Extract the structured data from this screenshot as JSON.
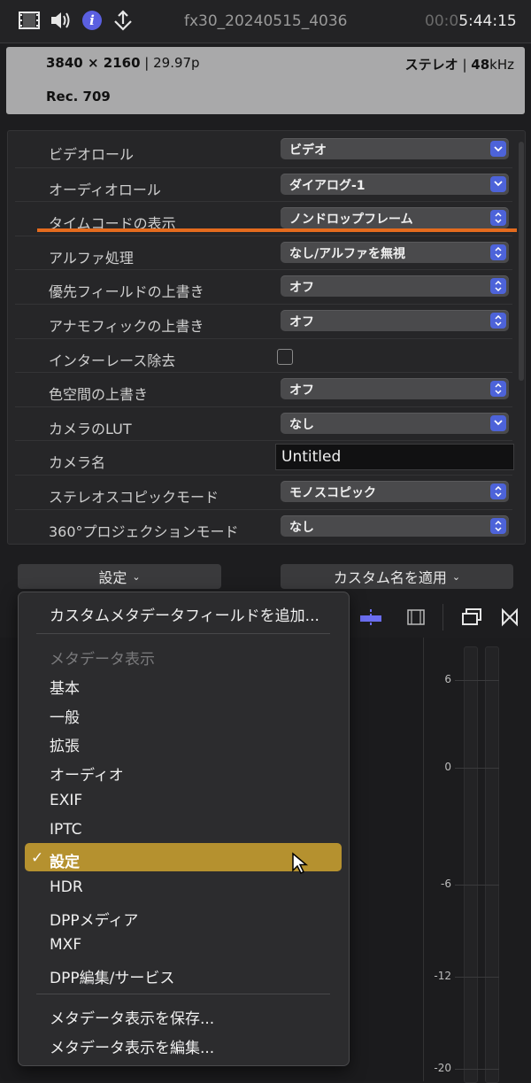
{
  "toolbar": {
    "clip_name": "fx30_20240515_4036",
    "timecode_dim": "00:0",
    "timecode": "5:44:15",
    "icons": [
      "film-icon",
      "speaker-icon",
      "info-icon",
      "share-icon"
    ]
  },
  "info": {
    "resolution": "3840 × 2160",
    "framerate": "29.97p",
    "audio_channels": "ステレオ",
    "sample_rate": "48",
    "sample_unit": "kHz",
    "color_space": "Rec. 709"
  },
  "settings": [
    {
      "label": "ビデオロール",
      "value": "ビデオ",
      "type": "select-down"
    },
    {
      "label": "オーディオロール",
      "value": "ダイアログ-1",
      "type": "select-down"
    },
    {
      "label": "タイムコードの表示",
      "value": "ノンドロップフレーム",
      "type": "select-updown"
    },
    {
      "label": "アルファ処理",
      "value": "なし/アルファを無視",
      "type": "select-updown"
    },
    {
      "label": "優先フィールドの上書き",
      "value": "オフ",
      "type": "select-updown"
    },
    {
      "label": "アナモフィックの上書き",
      "value": "オフ",
      "type": "select-updown"
    },
    {
      "label": "インターレース除去",
      "value": "",
      "type": "checkbox",
      "checked": false
    },
    {
      "label": "色空間の上書き",
      "value": "オフ",
      "type": "select-updown"
    },
    {
      "label": "カメラのLUT",
      "value": "なし",
      "type": "select-down"
    },
    {
      "label": "カメラ名",
      "value": "Untitled",
      "type": "text"
    },
    {
      "label": "ステレオスコピックモード",
      "value": "モノスコピック",
      "type": "select-updown"
    },
    {
      "label": "360°プロジェクションモード",
      "value": "なし",
      "type": "select-updown"
    }
  ],
  "buttons": {
    "settings_label": "設定",
    "apply_custom_name_label": "カスタム名を適用"
  },
  "menu": {
    "add_custom_field": "カスタムメタデータフィールドを追加...",
    "section_header": "メタデータ表示",
    "views": [
      "基本",
      "一般",
      "拡張",
      "オーディオ",
      "EXIF",
      "IPTC",
      "設定",
      "HDR",
      "DPPメディア",
      "MXF",
      "DPP編集/サービス"
    ],
    "selected_view": "設定",
    "save_view": "メタデータ表示を保存...",
    "edit_view": "メタデータ表示を編集..."
  },
  "meter": {
    "labels": [
      "6",
      "0",
      "-6",
      "-12",
      "-20"
    ]
  },
  "colors": {
    "accent_blue": "#4d63d9",
    "highlight": "#b5912f",
    "annotation_orange": "#e46b1e"
  }
}
